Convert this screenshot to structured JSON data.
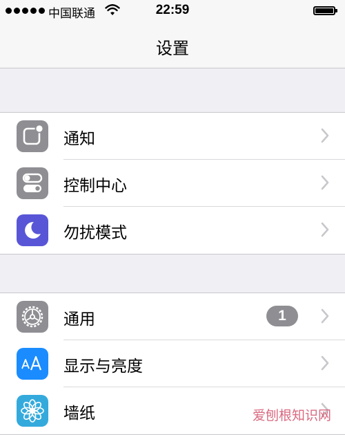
{
  "status_bar": {
    "carrier": "中国联通",
    "time": "22:59"
  },
  "nav": {
    "title": "设置"
  },
  "groups": [
    {
      "items": [
        {
          "label": "通知",
          "icon": "notifications-icon",
          "color": "#8e8e93"
        },
        {
          "label": "控制中心",
          "icon": "control-center-icon",
          "color": "#8e8e93"
        },
        {
          "label": "勿扰模式",
          "icon": "moon-icon",
          "color": "#5856d6"
        }
      ]
    },
    {
      "items": [
        {
          "label": "通用",
          "icon": "gear-icon",
          "color": "#8e8e93",
          "badge": "1"
        },
        {
          "label": "显示与亮度",
          "icon": "display-brightness-icon",
          "color": "#1a8cff"
        },
        {
          "label": "墙纸",
          "icon": "wallpaper-flower-icon",
          "color": "#34aadc"
        }
      ]
    }
  ],
  "watermark": "爱刨根知识网"
}
